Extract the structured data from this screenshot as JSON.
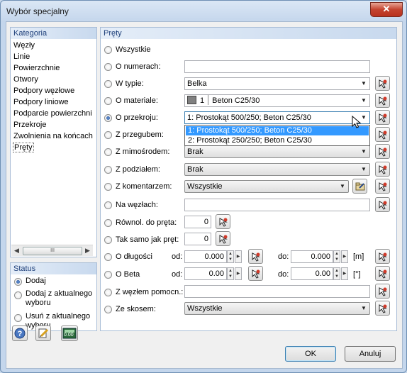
{
  "window": {
    "title": "Wybór specjalny",
    "close_glyph": "✕"
  },
  "kategoria": {
    "header": "Kategoria",
    "items": [
      "Węzły",
      "Linie",
      "Powierzchnie",
      "Otwory",
      "Podpory węzłowe",
      "Podpory liniowe",
      "Podparcie powierzchni",
      "Przekroje",
      "Zwolnienia na końcach",
      "Pręty"
    ],
    "selected": "Pręty",
    "scroll_thumb": "III"
  },
  "status": {
    "header": "Status",
    "options": [
      {
        "label_1": "Dodaj",
        "label_2": "",
        "checked": true
      },
      {
        "label_1": "Dodaj z aktualnego",
        "label_2": "wyboru",
        "checked": false
      },
      {
        "label_1": "Usuń z aktualnego",
        "label_2": "wyboru",
        "checked": false
      }
    ]
  },
  "prety": {
    "header": "Pręty",
    "wszystkie": {
      "label": "Wszystkie"
    },
    "o_numerach": {
      "label": "O numerach:",
      "value": ""
    },
    "w_typie": {
      "label": "W typie:",
      "value": "Belka"
    },
    "o_materiale": {
      "label": "O materiale:",
      "number": "1",
      "value": "Beton C25/30",
      "swatch_color": "#808080"
    },
    "o_przekroju": {
      "label": "O przekroju:",
      "value": "1: Prostokąt 500/250; Beton C25/30",
      "checked": true
    },
    "dropdown_options": [
      "1: Prostokąt 500/250; Beton C25/30",
      "2: Prostokąt 250/250; Beton C25/30"
    ],
    "z_przegubem": {
      "label": "Z przegubem:"
    },
    "z_mimosrodem": {
      "label": "Z mimośrodem:",
      "value": "Brak"
    },
    "z_podzialem": {
      "label": "Z podziałem:",
      "value": "Brak"
    },
    "z_komentarzem": {
      "label": "Z komentarzem:",
      "value": "Wszystkie"
    },
    "na_wezlach": {
      "label": "Na węzłach:",
      "value": ""
    },
    "rownol": {
      "label": "Równol. do pręta:",
      "value": "0"
    },
    "tak_samo": {
      "label": "Tak samo jak pręt:",
      "value": "0"
    },
    "o_dlugosci": {
      "label": "O długości",
      "od_label": "od:",
      "od_value": "0.000",
      "do_label": "do:",
      "do_value": "0.000",
      "unit": "[m]"
    },
    "o_beta": {
      "label": "O Beta",
      "od_label": "od:",
      "od_value": "0.00",
      "do_label": "do:",
      "do_value": "0.00",
      "unit": "[°]"
    },
    "z_wezlem": {
      "label": "Z węzłem pomocn.:",
      "value": ""
    },
    "ze_skosem": {
      "label": "Ze skosem:",
      "value": "Wszystkie"
    }
  },
  "buttons": {
    "ok": "OK",
    "cancel": "Anuluj",
    "units_icon_text": "0.00"
  },
  "colors": {
    "accent": "#3399ff",
    "panel_header_text": "#1e3f7a",
    "close_red": "#c4432f"
  }
}
